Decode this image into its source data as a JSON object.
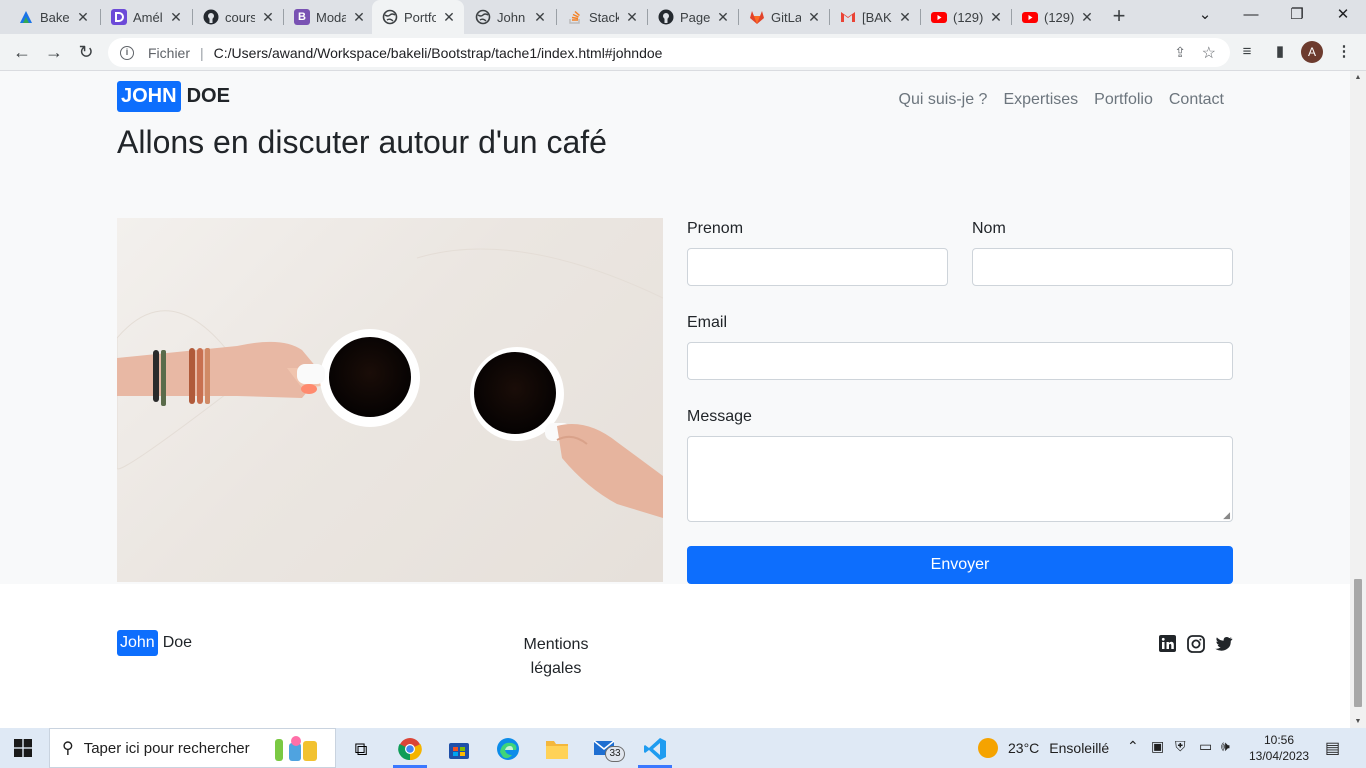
{
  "browser": {
    "tabs": [
      {
        "title": "Bakeli",
        "icon": "bakeli-logo-icon"
      },
      {
        "title": "Améliorer",
        "icon": "d-logo-icon"
      },
      {
        "title": "cours",
        "icon": "github-icon"
      },
      {
        "title": "Modal",
        "icon": "bootstrap-icon"
      },
      {
        "title": "Portfolio",
        "icon": "globe-icon",
        "active": true
      },
      {
        "title": "John",
        "icon": "globe-icon"
      },
      {
        "title": "Stack",
        "icon": "stackoverflow-icon"
      },
      {
        "title": "Page",
        "icon": "github-icon"
      },
      {
        "title": "GitLab",
        "icon": "gitlab-icon"
      },
      {
        "title": "[BAK",
        "icon": "gmail-icon"
      },
      {
        "title": "(129)",
        "icon": "youtube-icon"
      },
      {
        "title": "(129)",
        "icon": "youtube-icon"
      }
    ],
    "address": {
      "scheme_label": "Fichier",
      "url": "C:/Users/awand/Workspace/bakeli/Bootstrap/tache1/index.html#johndoe"
    },
    "profile_initial": "A"
  },
  "page": {
    "brand": {
      "part1": "JOHN",
      "part2": "DOE"
    },
    "nav": [
      "Qui suis-je ?",
      "Expertises",
      "Portfolio",
      "Contact"
    ],
    "heading": "Allons en discuter autour d'un café",
    "form": {
      "prenom_label": "Prenom",
      "nom_label": "Nom",
      "email_label": "Email",
      "message_label": "Message",
      "submit_label": "Envoyer"
    },
    "footer": {
      "brand_part1": "John",
      "brand_part2": "Doe",
      "mentions_line1": "Mentions",
      "mentions_line2": "légales",
      "social": [
        "linkedin-icon",
        "instagram-icon",
        "twitter-icon"
      ]
    },
    "colors": {
      "primary": "#0d6efd",
      "section_bg": "#f8f9fa"
    }
  },
  "taskbar": {
    "search_placeholder": "Taper ici pour rechercher",
    "mail_badge": "33",
    "weather": {
      "temp": "23°C",
      "condition": "Ensoleillé"
    },
    "time": "10:56",
    "date": "13/04/2023"
  }
}
